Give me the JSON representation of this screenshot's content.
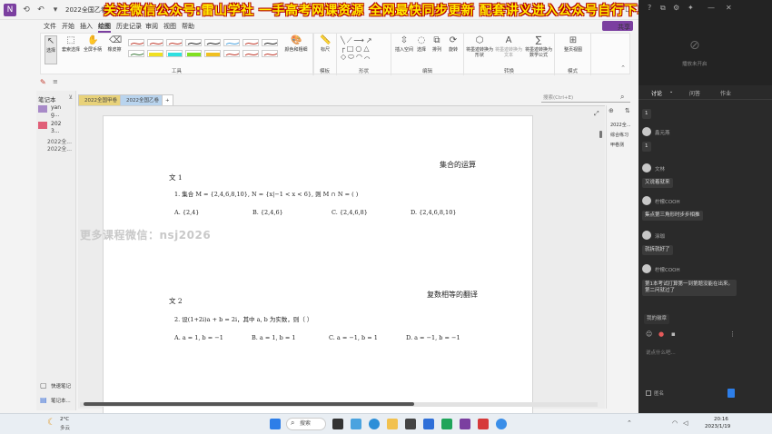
{
  "titlebar": {
    "doc_title": "2022全国乙卷真题",
    "watermark": "关注微信公众号:雷山学社 一手高考网课资源 全网最快同步更新 配套讲义进入公众号自行下单"
  },
  "menu": {
    "items": [
      "文件",
      "开始",
      "插入",
      "绘图",
      "历史记录",
      "审阅",
      "视图",
      "帮助"
    ],
    "active_index": 3,
    "share_label": "共享"
  },
  "ribbon": {
    "select_label": "选择",
    "lasso_label": "套索选择",
    "pan_label": "全屏手柄",
    "eraser_label": "橡皮擦",
    "tools_label": "工具",
    "ink_to_shape_label": "形状识别",
    "color_label": "颜色和粗细",
    "ruler_label": "标尺",
    "stencils_label": "模板",
    "shapes_label": "形状",
    "insert_space_label": "插入空间",
    "lasso2_label": "选择",
    "arrange_label": "排列",
    "rotate_label": "旋转",
    "edit_label": "编辑",
    "ink_to_text_label": "将墨迹转换为形状",
    "ink_to_math_label": "将墨迹转换为文本",
    "math_label": "将墨迹转换为数学公式",
    "convert_label": "转换",
    "view_label": "整页视图",
    "mode_label": "模式"
  },
  "notebook": {
    "header": "笔记本",
    "items": [
      "yan",
      "g...",
      "202",
      "3...",
      "2022全...",
      "2022全..."
    ],
    "quick_notes": "快速笔记",
    "more": "笔记本..."
  },
  "tabs": [
    "2022全国甲卷",
    "2022全国乙卷"
  ],
  "search_placeholder": "搜索(Ctrl+E)",
  "right_pages": [
    "2022全...",
    "综合练习",
    "甲卷测"
  ],
  "page": {
    "section1_title": "集合的运算",
    "q1_label": "文 1",
    "q1_text": "1. 集合 M = {2,4,6,8,10}, N = {x|−1 < x < 6}, 则 M ∩ N = (     )",
    "q1_options": [
      "A. {2,4}",
      "B. {2,4,6}",
      "C. {2,4,6,8}",
      "D. {2,4,6,8,10}"
    ],
    "section2_title": "复数相等的翻译",
    "q2_label": "文 2",
    "q2_text": "2. 设(1+2i)a + b = 2i，其中 a, b 为实数，则（     ）",
    "q2_options": [
      "A. a = 1, b = −1",
      "B. a = 1, b = 1",
      "C. a = −1, b = 1",
      "D. a = −1, b = −1"
    ],
    "watermark": "更多课程微信：nsj2026"
  },
  "chat": {
    "host_label": "播放未开启",
    "tabs": [
      "讨论",
      "问答",
      "作业"
    ],
    "messages": [
      {
        "name": "",
        "text": "1"
      },
      {
        "name": "鑫元燕",
        "text": "1"
      },
      {
        "name": "文林",
        "text": "又说着就来"
      },
      {
        "name": "柠檬COOH",
        "text": "集点第三角形时步步相推"
      },
      {
        "name": "涂珈",
        "text": "就拆就好了"
      },
      {
        "name": "柠檬COOH",
        "text": "第1本考试打算第一到第题没能在出来。第二问就过了"
      }
    ],
    "my_badge": "我的徽章",
    "input_placeholder": "说点什么吧...",
    "anonymous": "匿名"
  },
  "taskbar": {
    "weather_temp": "2°C",
    "weather_desc": "多云",
    "search_label": "搜索",
    "time": "20:16",
    "date": "2023/1/19"
  },
  "colors": {
    "accent": "#7b3fa0",
    "watermark_yellow": "#ffeb00",
    "watermark_red": "#b40000"
  }
}
